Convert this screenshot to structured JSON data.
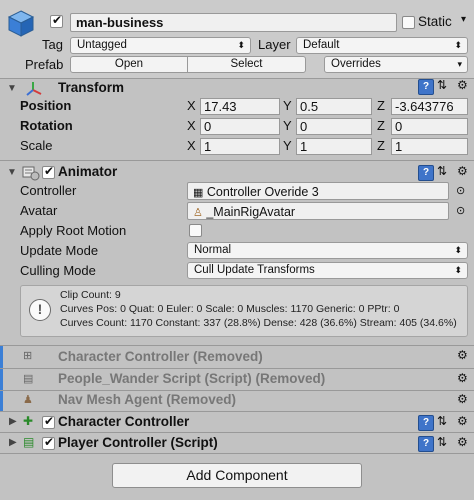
{
  "header": {
    "object_name": "man-business",
    "static_label": "Static",
    "tag_label": "Tag",
    "tag_value": "Untagged",
    "layer_label": "Layer",
    "layer_value": "Default",
    "prefab_label": "Prefab",
    "open_label": "Open",
    "select_label": "Select",
    "overrides_label": "Overrides"
  },
  "transform": {
    "title": "Transform",
    "position_label": "Position",
    "rotation_label": "Rotation",
    "scale_label": "Scale",
    "x": "X",
    "y": "Y",
    "z": "Z",
    "position": [
      "17.43",
      "0.5",
      "-3.643776"
    ],
    "rotation": [
      "0",
      "0",
      "0"
    ],
    "scale": [
      "1",
      "1",
      "1"
    ]
  },
  "animator": {
    "title": "Animator",
    "controller_label": "Controller",
    "controller_value": "Controller Overide 3",
    "avatar_label": "Avatar",
    "avatar_value": "_MainRigAvatar",
    "apply_root_motion_label": "Apply Root Motion",
    "update_mode_label": "Update Mode",
    "update_mode_value": "Normal",
    "culling_mode_label": "Culling Mode",
    "culling_mode_value": "Cull Update Transforms",
    "info_line1": "Clip Count: 9",
    "info_line2": "Curves Pos: 0 Quat: 0 Euler: 0 Scale: 0 Muscles: 1170 Generic: 0 PPtr: 0",
    "info_line3": "Curves Count: 1170 Constant: 337 (28.8%) Dense: 428 (36.6%) Stream: 405 (34.6%)"
  },
  "removed_components": [
    {
      "label": "Character Controller (Removed)"
    },
    {
      "label": "People_Wander Script (Script) (Removed)"
    },
    {
      "label": "Nav Mesh Agent (Removed)"
    }
  ],
  "components": [
    {
      "label": "Character Controller"
    },
    {
      "label": "Player Controller (Script)"
    }
  ],
  "add_component_label": "Add Component",
  "colors": {
    "background": "#c2c2c2",
    "header": "#cbcbcb",
    "field": "#f0f0f0",
    "accent_blue": "#3b7fd6"
  },
  "icons": [
    "cube-icon",
    "transform-icon",
    "animator-icon",
    "help-icon",
    "preset-icon",
    "gear-icon",
    "info-icon"
  ]
}
